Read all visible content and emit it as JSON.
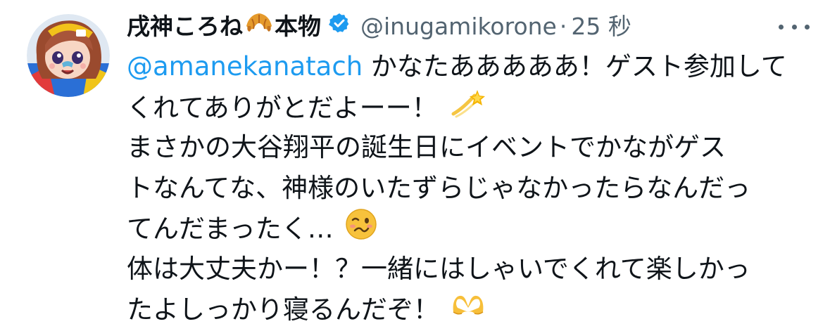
{
  "tweet": {
    "author": {
      "display_name": "戌神ころね",
      "name_suffix": "本物",
      "name_emoji": "croissant-emoji",
      "verified_icon": "verified-badge-icon",
      "handle": "@inugamikorone",
      "separator": "·",
      "time": "25 秒",
      "avatar": "avatar-anime-dog-girl"
    },
    "more_icon": "more-options-icon",
    "lines": [
      {
        "mention": "@amanekanatach",
        "text": " かなたあああああ！ゲスト参加して"
      },
      {
        "text": "くれてありがとだよーー！",
        "emoji": "dizzy-emoji"
      },
      {
        "text": "まさかの大谷翔平の誕生日にイベントでかながゲス"
      },
      {
        "text": "トなんてな、神様のいたずらじゃなかったらなんだっ"
      },
      {
        "text": "てんだまったく…",
        "emoji": "woozy-face-emoji"
      },
      {
        "text": "体は大丈夫かー！？一緒にはしゃいでくれて楽しかっ"
      },
      {
        "text": "たよしっかり寝るんだぞ！",
        "emoji": "heart-hands-emoji"
      }
    ],
    "colors": {
      "text": "#0f1419",
      "secondary": "#536471",
      "accent": "#1d9bf0"
    }
  }
}
